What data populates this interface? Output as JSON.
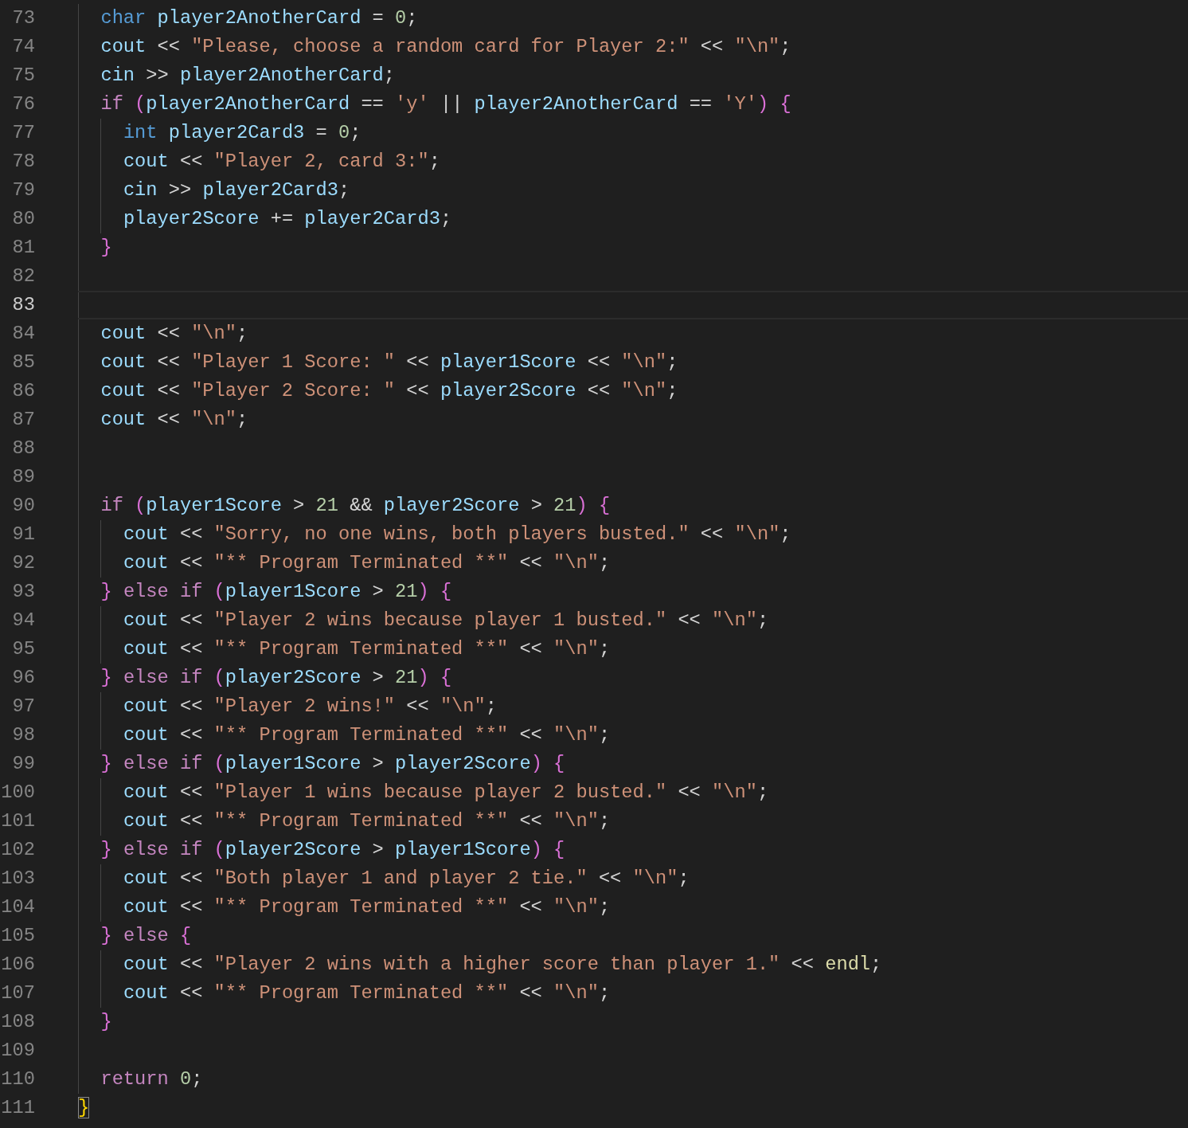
{
  "editor": {
    "lines": [
      {
        "number": "73",
        "selected": false,
        "tokens": [
          {
            "kind": "type",
            "text": "  char "
          },
          {
            "kind": "variable",
            "text": "player2AnotherCard"
          },
          {
            "kind": "punct",
            "text": " = "
          },
          {
            "kind": "number",
            "text": "0"
          },
          {
            "kind": "punct",
            "text": ";"
          }
        ]
      },
      {
        "number": "74",
        "selected": false,
        "tokens": [
          {
            "kind": "variable",
            "text": "  cout"
          },
          {
            "kind": "punct",
            "text": " << "
          },
          {
            "kind": "string",
            "text": "\"Please, choose a random card for Player 2:\""
          },
          {
            "kind": "punct",
            "text": " << "
          },
          {
            "kind": "string",
            "text": "\"\\n\""
          },
          {
            "kind": "punct",
            "text": ";"
          }
        ]
      },
      {
        "number": "75",
        "selected": false,
        "tokens": [
          {
            "kind": "variable",
            "text": "  cin"
          },
          {
            "kind": "punct",
            "text": " >> "
          },
          {
            "kind": "variable",
            "text": "player2AnotherCard"
          },
          {
            "kind": "punct",
            "text": ";"
          }
        ]
      },
      {
        "number": "76",
        "selected": false,
        "tokens": [
          {
            "kind": "control",
            "text": "  if "
          },
          {
            "kind": "bracket",
            "text": "("
          },
          {
            "kind": "variable",
            "text": "player2AnotherCard"
          },
          {
            "kind": "punct",
            "text": " == "
          },
          {
            "kind": "string",
            "text": "'y'"
          },
          {
            "kind": "punct",
            "text": " || "
          },
          {
            "kind": "variable",
            "text": "player2AnotherCard"
          },
          {
            "kind": "punct",
            "text": " == "
          },
          {
            "kind": "string",
            "text": "'Y'"
          },
          {
            "kind": "bracket",
            "text": ") {"
          }
        ]
      },
      {
        "number": "77",
        "selected": false,
        "tokens": [
          {
            "kind": "type",
            "text": "    int "
          },
          {
            "kind": "variable",
            "text": "player2Card3"
          },
          {
            "kind": "punct",
            "text": " = "
          },
          {
            "kind": "number",
            "text": "0"
          },
          {
            "kind": "punct",
            "text": ";"
          }
        ]
      },
      {
        "number": "78",
        "selected": false,
        "tokens": [
          {
            "kind": "variable",
            "text": "    cout"
          },
          {
            "kind": "punct",
            "text": " << "
          },
          {
            "kind": "string",
            "text": "\"Player 2, card 3:\""
          },
          {
            "kind": "punct",
            "text": ";"
          }
        ]
      },
      {
        "number": "79",
        "selected": false,
        "tokens": [
          {
            "kind": "variable",
            "text": "    cin"
          },
          {
            "kind": "punct",
            "text": " >> "
          },
          {
            "kind": "variable",
            "text": "player2Card3"
          },
          {
            "kind": "punct",
            "text": ";"
          }
        ]
      },
      {
        "number": "80",
        "selected": false,
        "tokens": [
          {
            "kind": "variable",
            "text": "    player2Score"
          },
          {
            "kind": "punct",
            "text": " += "
          },
          {
            "kind": "variable",
            "text": "player2Card3"
          },
          {
            "kind": "punct",
            "text": ";"
          }
        ]
      },
      {
        "number": "81",
        "selected": false,
        "tokens": [
          {
            "kind": "bracket",
            "text": "  }"
          }
        ]
      },
      {
        "number": "82",
        "selected": false
      },
      {
        "number": "83",
        "selected": true
      },
      {
        "number": "84",
        "selected": false,
        "tokens": [
          {
            "kind": "variable",
            "text": "  cout"
          },
          {
            "kind": "punct",
            "text": " << "
          },
          {
            "kind": "string",
            "text": "\"\\n\""
          },
          {
            "kind": "punct",
            "text": ";"
          }
        ]
      },
      {
        "number": "85",
        "selected": false,
        "tokens": [
          {
            "kind": "variable",
            "text": "  cout"
          },
          {
            "kind": "punct",
            "text": " << "
          },
          {
            "kind": "string",
            "text": "\"Player 1 Score: \""
          },
          {
            "kind": "punct",
            "text": " << "
          },
          {
            "kind": "variable",
            "text": "player1Score"
          },
          {
            "kind": "punct",
            "text": " << "
          },
          {
            "kind": "string",
            "text": "\"\\n\""
          },
          {
            "kind": "punct",
            "text": ";"
          }
        ]
      },
      {
        "number": "86",
        "selected": false,
        "tokens": [
          {
            "kind": "variable",
            "text": "  cout"
          },
          {
            "kind": "punct",
            "text": " << "
          },
          {
            "kind": "string",
            "text": "\"Player 2 Score: \""
          },
          {
            "kind": "punct",
            "text": " << "
          },
          {
            "kind": "variable",
            "text": "player2Score"
          },
          {
            "kind": "punct",
            "text": " << "
          },
          {
            "kind": "string",
            "text": "\"\\n\""
          },
          {
            "kind": "punct",
            "text": ";"
          }
        ]
      },
      {
        "number": "87",
        "selected": false,
        "tokens": [
          {
            "kind": "variable",
            "text": "  cout"
          },
          {
            "kind": "punct",
            "text": " << "
          },
          {
            "kind": "string",
            "text": "\"\\n\""
          },
          {
            "kind": "punct",
            "text": ";"
          }
        ]
      },
      {
        "number": "88",
        "selected": false
      },
      {
        "number": "89",
        "selected": false
      },
      {
        "number": "90",
        "selected": false,
        "tokens": [
          {
            "kind": "control",
            "text": "  if "
          },
          {
            "kind": "bracket",
            "text": "("
          },
          {
            "kind": "variable",
            "text": "player1Score"
          },
          {
            "kind": "punct",
            "text": " > "
          },
          {
            "kind": "number",
            "text": "21"
          },
          {
            "kind": "punct",
            "text": " && "
          },
          {
            "kind": "variable",
            "text": "player2Score"
          },
          {
            "kind": "punct",
            "text": " > "
          },
          {
            "kind": "number",
            "text": "21"
          },
          {
            "kind": "bracket",
            "text": ") {"
          }
        ]
      },
      {
        "number": "91",
        "selected": false,
        "tokens": [
          {
            "kind": "variable",
            "text": "    cout"
          },
          {
            "kind": "punct",
            "text": " << "
          },
          {
            "kind": "string",
            "text": "\"Sorry, no one wins, both players busted.\""
          },
          {
            "kind": "punct",
            "text": " << "
          },
          {
            "kind": "string",
            "text": "\"\\n\""
          },
          {
            "kind": "punct",
            "text": ";"
          }
        ]
      },
      {
        "number": "92",
        "selected": false,
        "tokens": [
          {
            "kind": "variable",
            "text": "    cout"
          },
          {
            "kind": "punct",
            "text": " << "
          },
          {
            "kind": "string",
            "text": "\"** Program Terminated **\""
          },
          {
            "kind": "punct",
            "text": " << "
          },
          {
            "kind": "string",
            "text": "\"\\n\""
          },
          {
            "kind": "punct",
            "text": ";"
          }
        ]
      },
      {
        "number": "93",
        "selected": false,
        "tokens": [
          {
            "kind": "bracket",
            "text": "  } "
          },
          {
            "kind": "control",
            "text": "else if "
          },
          {
            "kind": "bracket",
            "text": "("
          },
          {
            "kind": "variable",
            "text": "player1Score"
          },
          {
            "kind": "punct",
            "text": " > "
          },
          {
            "kind": "number",
            "text": "21"
          },
          {
            "kind": "bracket",
            "text": ") {"
          }
        ]
      },
      {
        "number": "94",
        "selected": false,
        "tokens": [
          {
            "kind": "variable",
            "text": "    cout"
          },
          {
            "kind": "punct",
            "text": " << "
          },
          {
            "kind": "string",
            "text": "\"Player 2 wins because player 1 busted.\""
          },
          {
            "kind": "punct",
            "text": " << "
          },
          {
            "kind": "string",
            "text": "\"\\n\""
          },
          {
            "kind": "punct",
            "text": ";"
          }
        ]
      },
      {
        "number": "95",
        "selected": false,
        "tokens": [
          {
            "kind": "variable",
            "text": "    cout"
          },
          {
            "kind": "punct",
            "text": " << "
          },
          {
            "kind": "string",
            "text": "\"** Program Terminated **\""
          },
          {
            "kind": "punct",
            "text": " << "
          },
          {
            "kind": "string",
            "text": "\"\\n\""
          },
          {
            "kind": "punct",
            "text": ";"
          }
        ]
      },
      {
        "number": "96",
        "selected": false,
        "tokens": [
          {
            "kind": "bracket",
            "text": "  } "
          },
          {
            "kind": "control",
            "text": "else if "
          },
          {
            "kind": "bracket",
            "text": "("
          },
          {
            "kind": "variable",
            "text": "player2Score"
          },
          {
            "kind": "punct",
            "text": " > "
          },
          {
            "kind": "number",
            "text": "21"
          },
          {
            "kind": "bracket",
            "text": ") {"
          }
        ]
      },
      {
        "number": "97",
        "selected": false,
        "tokens": [
          {
            "kind": "variable",
            "text": "    cout"
          },
          {
            "kind": "punct",
            "text": " << "
          },
          {
            "kind": "string",
            "text": "\"Player 2 wins!\""
          },
          {
            "kind": "punct",
            "text": " << "
          },
          {
            "kind": "string",
            "text": "\"\\n\""
          },
          {
            "kind": "punct",
            "text": ";"
          }
        ]
      },
      {
        "number": "98",
        "selected": false,
        "tokens": [
          {
            "kind": "variable",
            "text": "    cout"
          },
          {
            "kind": "punct",
            "text": " << "
          },
          {
            "kind": "string",
            "text": "\"** Program Terminated **\""
          },
          {
            "kind": "punct",
            "text": " << "
          },
          {
            "kind": "string",
            "text": "\"\\n\""
          },
          {
            "kind": "punct",
            "text": ";"
          }
        ]
      },
      {
        "number": "99",
        "selected": false,
        "tokens": [
          {
            "kind": "bracket",
            "text": "  } "
          },
          {
            "kind": "control",
            "text": "else if "
          },
          {
            "kind": "bracket",
            "text": "("
          },
          {
            "kind": "variable",
            "text": "player1Score"
          },
          {
            "kind": "punct",
            "text": " > "
          },
          {
            "kind": "variable",
            "text": "player2Score"
          },
          {
            "kind": "bracket",
            "text": ") {"
          }
        ]
      },
      {
        "number": "100",
        "selected": false,
        "tokens": [
          {
            "kind": "variable",
            "text": "    cout"
          },
          {
            "kind": "punct",
            "text": " << "
          },
          {
            "kind": "string",
            "text": "\"Player 1 wins because player 2 busted.\""
          },
          {
            "kind": "punct",
            "text": " << "
          },
          {
            "kind": "string",
            "text": "\"\\n\""
          },
          {
            "kind": "punct",
            "text": ";"
          }
        ]
      },
      {
        "number": "101",
        "selected": false,
        "tokens": [
          {
            "kind": "variable",
            "text": "    cout"
          },
          {
            "kind": "punct",
            "text": " << "
          },
          {
            "kind": "string",
            "text": "\"** Program Terminated **\""
          },
          {
            "kind": "punct",
            "text": " << "
          },
          {
            "kind": "string",
            "text": "\"\\n\""
          },
          {
            "kind": "punct",
            "text": ";"
          }
        ]
      },
      {
        "number": "102",
        "selected": false,
        "tokens": [
          {
            "kind": "bracket",
            "text": "  } "
          },
          {
            "kind": "control",
            "text": "else if "
          },
          {
            "kind": "bracket",
            "text": "("
          },
          {
            "kind": "variable",
            "text": "player2Score"
          },
          {
            "kind": "punct",
            "text": " > "
          },
          {
            "kind": "variable",
            "text": "player1Score"
          },
          {
            "kind": "bracket",
            "text": ") {"
          }
        ]
      },
      {
        "number": "103",
        "selected": false,
        "tokens": [
          {
            "kind": "variable",
            "text": "    cout"
          },
          {
            "kind": "punct",
            "text": " << "
          },
          {
            "kind": "string",
            "text": "\"Both player 1 and player 2 tie.\""
          },
          {
            "kind": "punct",
            "text": " << "
          },
          {
            "kind": "string",
            "text": "\"\\n\""
          },
          {
            "kind": "punct",
            "text": ";"
          }
        ]
      },
      {
        "number": "104",
        "selected": false,
        "tokens": [
          {
            "kind": "variable",
            "text": "    cout"
          },
          {
            "kind": "punct",
            "text": " << "
          },
          {
            "kind": "string",
            "text": "\"** Program Terminated **\""
          },
          {
            "kind": "punct",
            "text": " << "
          },
          {
            "kind": "string",
            "text": "\"\\n\""
          },
          {
            "kind": "punct",
            "text": ";"
          }
        ]
      },
      {
        "number": "105",
        "selected": false,
        "tokens": [
          {
            "kind": "bracket",
            "text": "  } "
          },
          {
            "kind": "control",
            "text": "else "
          },
          {
            "kind": "bracket",
            "text": "{"
          }
        ]
      },
      {
        "number": "106",
        "selected": false,
        "tokens": [
          {
            "kind": "variable",
            "text": "    cout"
          },
          {
            "kind": "punct",
            "text": " << "
          },
          {
            "kind": "string",
            "text": "\"Player 2 wins with a higher score than player 1.\""
          },
          {
            "kind": "punct",
            "text": " << "
          },
          {
            "kind": "function",
            "text": "endl"
          },
          {
            "kind": "punct",
            "text": ";"
          }
        ]
      },
      {
        "number": "107",
        "selected": false,
        "tokens": [
          {
            "kind": "variable",
            "text": "    cout"
          },
          {
            "kind": "punct",
            "text": " << "
          },
          {
            "kind": "string",
            "text": "\"** Program Terminated **\""
          },
          {
            "kind": "punct",
            "text": " << "
          },
          {
            "kind": "string",
            "text": "\"\\n\""
          },
          {
            "kind": "punct",
            "text": ";"
          }
        ]
      },
      {
        "number": "108",
        "selected": false,
        "tokens": [
          {
            "kind": "bracket",
            "text": "  }"
          }
        ]
      },
      {
        "number": "109",
        "selected": false
      },
      {
        "number": "110",
        "selected": false,
        "tokens": [
          {
            "kind": "control",
            "text": "  return "
          },
          {
            "kind": "number",
            "text": "0"
          },
          {
            "kind": "punct",
            "text": ";"
          }
        ]
      },
      {
        "number": "111",
        "selected": false,
        "tokens": [
          {
            "kind": "match",
            "text": "}"
          }
        ]
      }
    ]
  }
}
